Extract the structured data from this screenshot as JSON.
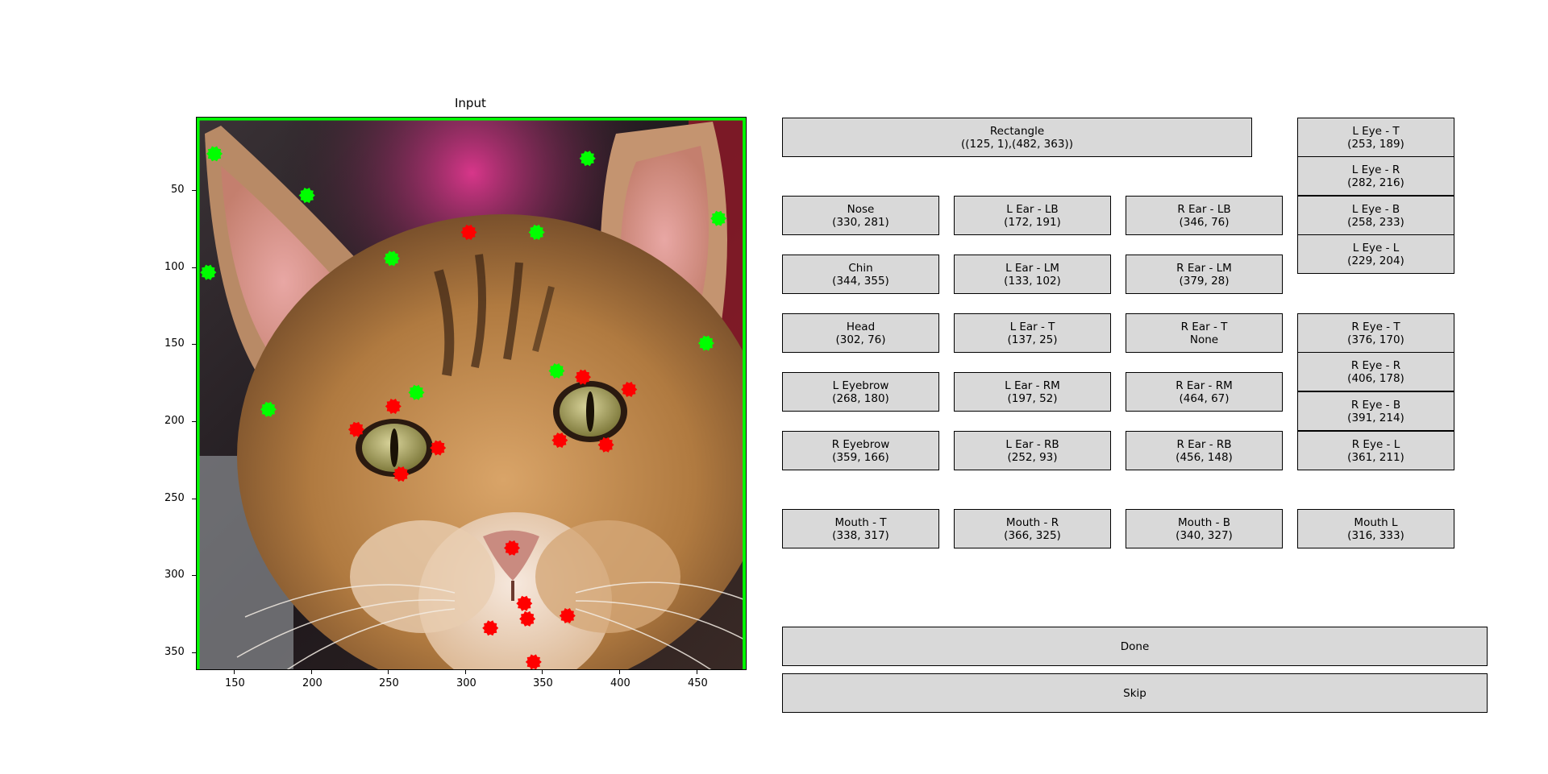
{
  "plot": {
    "title": "Input",
    "x_ticks": [
      "150",
      "200",
      "250",
      "300",
      "350",
      "400",
      "450"
    ],
    "y_ticks": [
      "50",
      "100",
      "150",
      "200",
      "250",
      "300",
      "350"
    ],
    "rectangle_color": "#00ff00",
    "green_color": "#00ff00",
    "red_color": "#ff0000"
  },
  "buttons": {
    "rectangle": {
      "label": "Rectangle",
      "value": "((125, 1),(482, 363))"
    },
    "nose": {
      "label": "Nose",
      "value": "(330, 281)"
    },
    "chin": {
      "label": "Chin",
      "value": "(344, 355)"
    },
    "head": {
      "label": "Head",
      "value": "(302, 76)"
    },
    "l_eyebrow": {
      "label": "L Eyebrow",
      "value": "(268, 180)"
    },
    "r_eyebrow": {
      "label": "R Eyebrow",
      "value": "(359, 166)"
    },
    "l_ear_lb": {
      "label": "L Ear - LB",
      "value": "(172, 191)"
    },
    "l_ear_lm": {
      "label": "L Ear - LM",
      "value": "(133, 102)"
    },
    "l_ear_t": {
      "label": "L Ear - T",
      "value": "(137, 25)"
    },
    "l_ear_rm": {
      "label": "L Ear - RM",
      "value": "(197, 52)"
    },
    "l_ear_rb": {
      "label": "L Ear - RB",
      "value": "(252, 93)"
    },
    "r_ear_lb": {
      "label": "R Ear - LB",
      "value": "(346, 76)"
    },
    "r_ear_lm": {
      "label": "R Ear - LM",
      "value": "(379, 28)"
    },
    "r_ear_t": {
      "label": "R Ear - T",
      "value": "None"
    },
    "r_ear_rm": {
      "label": "R Ear - RM",
      "value": "(464, 67)"
    },
    "r_ear_rb": {
      "label": "R Ear - RB",
      "value": "(456, 148)"
    },
    "l_eye_t": {
      "label": "L Eye - T",
      "value": "(253, 189)"
    },
    "l_eye_r": {
      "label": "L Eye - R",
      "value": "(282, 216)"
    },
    "l_eye_b": {
      "label": "L Eye - B",
      "value": "(258, 233)"
    },
    "l_eye_l": {
      "label": "L Eye - L",
      "value": "(229, 204)"
    },
    "r_eye_t": {
      "label": "R Eye - T",
      "value": "(376, 170)"
    },
    "r_eye_r": {
      "label": "R Eye - R",
      "value": "(406, 178)"
    },
    "r_eye_b": {
      "label": "R Eye - B",
      "value": "(391, 214)"
    },
    "r_eye_l": {
      "label": "R Eye - L",
      "value": "(361, 211)"
    },
    "mouth_t": {
      "label": "Mouth - T",
      "value": "(338, 317)"
    },
    "mouth_r": {
      "label": "Mouth - R",
      "value": "(366, 325)"
    },
    "mouth_b": {
      "label": "Mouth - B",
      "value": "(340, 327)"
    },
    "mouth_l": {
      "label": "Mouth L",
      "value": "(316, 333)"
    },
    "done": {
      "label": "Done"
    },
    "skip": {
      "label": "Skip"
    }
  }
}
